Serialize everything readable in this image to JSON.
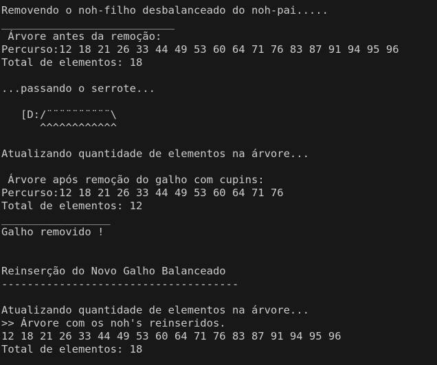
{
  "terminal": {
    "lines": [
      "Removendo o noh-filho desbalanceado do noh-pai.....",
      "___________________________",
      " Árvore antes da remoção:",
      "Percurso:12 18 21 26 33 44 49 53 60 64 71 76 83 87 91 94 95 96",
      "Total de elementos: 18",
      "",
      "...passando o serrote...",
      "",
      "   [D:/¨¨¨¨¨¨¨¨¨¨\\",
      "      ^^^^^^^^^^^^",
      "",
      "Atualizando quantidade de elementos na árvore...",
      "",
      " Árvore após remoção do galho com cupins:",
      "Percurso:12 18 21 26 33 44 49 53 60 64 71 76",
      "Total de elementos: 12",
      "_________________",
      "Galho removido !",
      "",
      "",
      "Reinserção do Novo Galho Balanceado",
      "-------------------------------------",
      "",
      "Atualizando quantidade de elementos na árvore...",
      ">> Árvore com os noh's reinseridos.",
      "12 18 21 26 33 44 49 53 60 64 71 76 83 87 91 94 95 96",
      "Total de elementos: 18"
    ]
  }
}
